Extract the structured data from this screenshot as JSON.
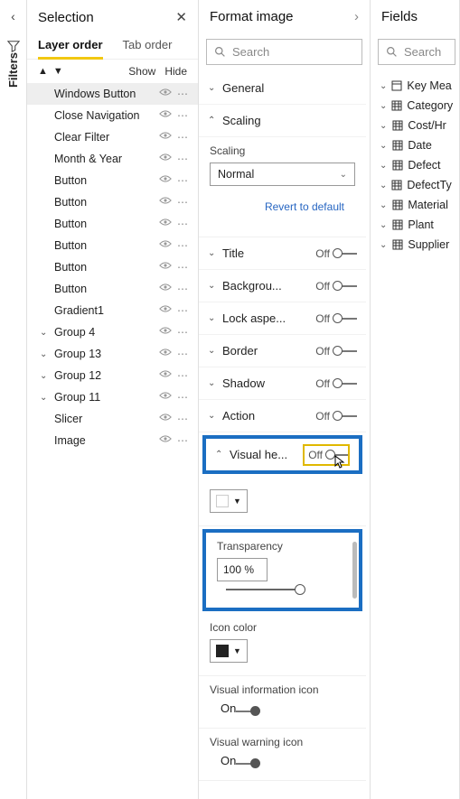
{
  "filters_label": "Filters",
  "selection": {
    "title": "Selection",
    "tabs": {
      "layer": "Layer order",
      "tab": "Tab order"
    },
    "actions": {
      "show": "Show",
      "hide": "Hide"
    },
    "layers": [
      {
        "name": "Windows Button",
        "selected": true
      },
      {
        "name": "Close Navigation"
      },
      {
        "name": "Clear Filter"
      },
      {
        "name": "Month & Year"
      },
      {
        "name": "Button"
      },
      {
        "name": "Button"
      },
      {
        "name": "Button"
      },
      {
        "name": "Button"
      },
      {
        "name": "Button"
      },
      {
        "name": "Button"
      },
      {
        "name": "Gradient1"
      },
      {
        "name": "Group 4",
        "group": true
      },
      {
        "name": "Group 13",
        "group": true
      },
      {
        "name": "Group 12",
        "group": true
      },
      {
        "name": "Group 11",
        "group": true
      },
      {
        "name": "Slicer"
      },
      {
        "name": "Image"
      }
    ]
  },
  "format": {
    "title": "Format image",
    "search_placeholder": "Search",
    "general": "General",
    "scaling": {
      "title": "Scaling",
      "label": "Scaling",
      "value": "Normal",
      "revert": "Revert to default"
    },
    "rows": [
      {
        "label": "Title",
        "state": "Off"
      },
      {
        "label": "Backgrou...",
        "state": "Off"
      },
      {
        "label": "Lock aspe...",
        "state": "Off"
      },
      {
        "label": "Border",
        "state": "Off"
      },
      {
        "label": "Shadow",
        "state": "Off"
      },
      {
        "label": "Action",
        "state": "Off"
      }
    ],
    "visual_header": {
      "label": "Visual he...",
      "state": "Off"
    },
    "transparency": {
      "label": "Transparency",
      "value": "100 %"
    },
    "icon_color": {
      "label": "Icon color"
    },
    "visual_info": {
      "label": "Visual information icon",
      "state": "On"
    },
    "visual_warn": {
      "label": "Visual warning icon",
      "state": "On"
    }
  },
  "fields": {
    "title": "Fields",
    "search_placeholder": "Search",
    "items": [
      {
        "name": "Key Mea",
        "icon": "single"
      },
      {
        "name": "Category",
        "icon": "table"
      },
      {
        "name": "Cost/Hr",
        "icon": "table"
      },
      {
        "name": "Date",
        "icon": "table"
      },
      {
        "name": "Defect",
        "icon": "table"
      },
      {
        "name": "DefectTy",
        "icon": "table"
      },
      {
        "name": "Material",
        "icon": "table"
      },
      {
        "name": "Plant",
        "icon": "table"
      },
      {
        "name": "Supplier",
        "icon": "table"
      }
    ]
  }
}
